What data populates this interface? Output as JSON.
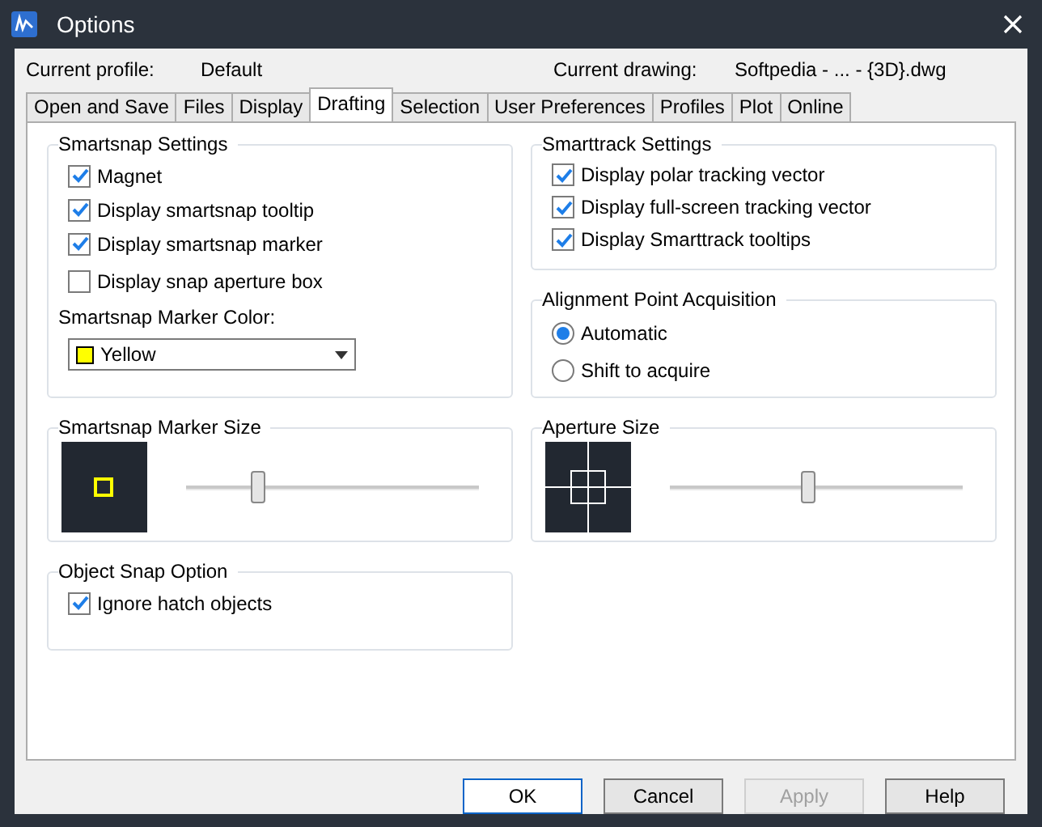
{
  "window": {
    "title": "Options"
  },
  "profile": {
    "label": "Current profile:",
    "value": "Default"
  },
  "drawing": {
    "label": "Current drawing:",
    "value": "Softpedia - ... - {3D}.dwg"
  },
  "tabs": [
    {
      "label": "Open and Save",
      "selected": false
    },
    {
      "label": "Files",
      "selected": false
    },
    {
      "label": "Display",
      "selected": false
    },
    {
      "label": "Drafting",
      "selected": true
    },
    {
      "label": "Selection",
      "selected": false
    },
    {
      "label": "User Preferences",
      "selected": false
    },
    {
      "label": "Profiles",
      "selected": false
    },
    {
      "label": "Plot",
      "selected": false
    },
    {
      "label": "Online",
      "selected": false
    }
  ],
  "smartsnap_settings": {
    "title": "Smartsnap Settings",
    "options": [
      {
        "label": "Magnet",
        "checked": true
      },
      {
        "label": "Display smartsnap tooltip",
        "checked": true
      },
      {
        "label": "Display smartsnap marker",
        "checked": true
      },
      {
        "label": "Display snap aperture box",
        "checked": false
      }
    ],
    "color_label": "Smartsnap Marker Color:",
    "color_value": "Yellow",
    "color": "#ffff00"
  },
  "smarttrack_settings": {
    "title": "Smarttrack Settings",
    "options": [
      {
        "label": "Display polar tracking vector",
        "checked": true
      },
      {
        "label": "Display full-screen tracking vector",
        "checked": true
      },
      {
        "label": "Display Smarttrack tooltips",
        "checked": true
      }
    ]
  },
  "alignment": {
    "title": "Alignment Point Acquisition",
    "options": [
      {
        "label": "Automatic",
        "selected": true
      },
      {
        "label": "Shift to acquire",
        "selected": false
      }
    ]
  },
  "marker_size": {
    "title": "Smartsnap Marker Size",
    "level": 0.23
  },
  "aperture_size": {
    "title": "Aperture Size",
    "level": 0.47
  },
  "object_snap": {
    "title": "Object Snap Option",
    "options": [
      {
        "label": "Ignore hatch objects",
        "checked": true
      }
    ]
  },
  "buttons": [
    {
      "label": "OK",
      "kind": "default",
      "disabled": false
    },
    {
      "label": "Cancel",
      "kind": "normal",
      "disabled": false
    },
    {
      "label": "Apply",
      "kind": "normal",
      "disabled": true
    },
    {
      "label": "Help",
      "kind": "normal",
      "disabled": false
    }
  ]
}
